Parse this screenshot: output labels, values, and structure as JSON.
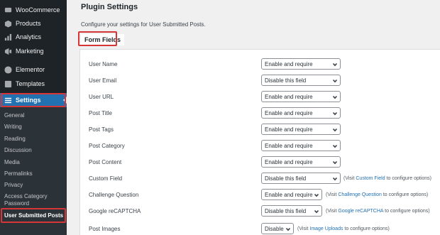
{
  "sidebar": {
    "menu": [
      {
        "label": "WooCommerce",
        "icon": "woocommerce-icon"
      },
      {
        "label": "Products",
        "icon": "products-icon"
      },
      {
        "label": "Analytics",
        "icon": "analytics-icon"
      },
      {
        "label": "Marketing",
        "icon": "marketing-icon"
      },
      {
        "label": "Elementor",
        "icon": "elementor-icon"
      },
      {
        "label": "Templates",
        "icon": "templates-icon"
      },
      {
        "label": "Settings",
        "icon": "settings-icon"
      }
    ],
    "submenu": [
      "General",
      "Writing",
      "Reading",
      "Discussion",
      "Media",
      "Permalinks",
      "Privacy",
      "Access Category Password",
      "User Submitted Posts"
    ],
    "active_color": "#2271b1",
    "highlight_color": "#d63638"
  },
  "main": {
    "title": "Plugin Settings",
    "description": "Configure your settings for User Submitted Posts.",
    "section": "Form Fields",
    "fields": [
      {
        "label": "User Name",
        "value": "Enable and require"
      },
      {
        "label": "User Email",
        "value": "Disable this field"
      },
      {
        "label": "User URL",
        "value": "Enable and require"
      },
      {
        "label": "Post Title",
        "value": "Enable and require"
      },
      {
        "label": "Post Tags",
        "value": "Enable and require"
      },
      {
        "label": "Post Category",
        "value": "Enable and require"
      },
      {
        "label": "Post Content",
        "value": "Enable and require"
      },
      {
        "label": "Custom Field",
        "value": "Disable this field",
        "visit_pre": "(Visit ",
        "visit_link": "Custom Field",
        "visit_post": " to configure options)"
      },
      {
        "label": "Challenge Question",
        "value": "Enable and require",
        "visit_pre": "(Visit ",
        "visit_link": "Challenge Question",
        "visit_post": " to configure options)"
      },
      {
        "label": "Google reCAPTCHA",
        "value": "Disable this field",
        "visit_pre": "(Visit ",
        "visit_link": "Google reCAPTCHA",
        "visit_post": " to configure options)"
      },
      {
        "label": "Post Images",
        "value": "Disable",
        "visit_pre": "(Visit ",
        "visit_link": "Image Uploads",
        "visit_post": " to configure options)"
      }
    ]
  }
}
